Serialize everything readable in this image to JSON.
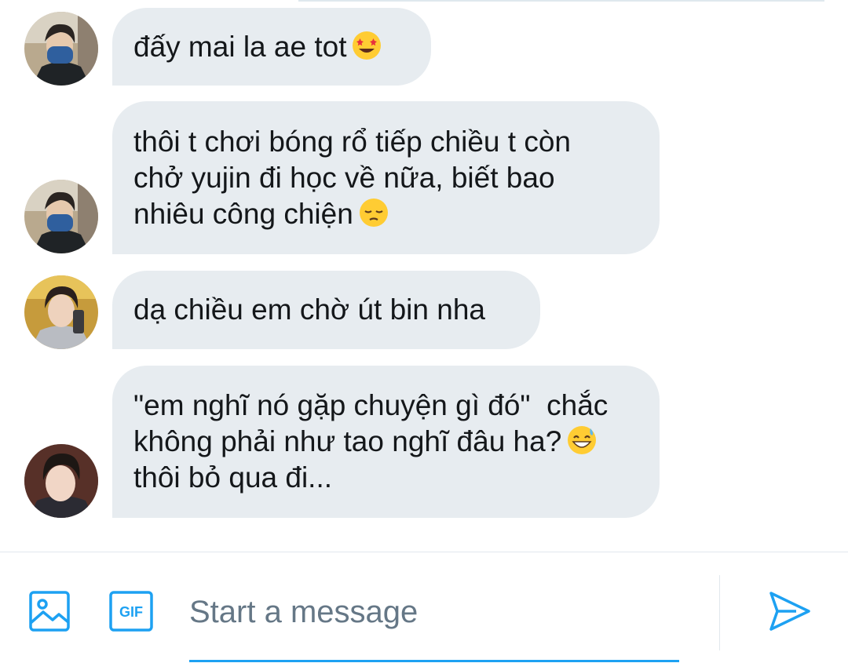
{
  "messages": [
    {
      "text": "đấy mai la ae tot",
      "emoji": "star-struck-emoji"
    },
    {
      "text": "thôi t chơi bóng rổ tiếp chiều t còn\nchở yujin đi học về nữa, biết bao\nnhiêu công chiện",
      "emoji": "pensive-face-emoji"
    },
    {
      "text": "dạ chiều em chờ út bin nha",
      "emoji": ""
    },
    {
      "text": "\"em nghĩ nó gặp chuyện gì đó\"  chắc\nkhông phải như tao nghĩ đâu ha?",
      "text_after_emoji": "thôi bỏ qua đi...",
      "emoji": "grinning-sweat-emoji"
    }
  ],
  "composer": {
    "placeholder": "Start a message",
    "image_icon": "image-icon",
    "gif_icon": "gif-icon",
    "gif_label": "GIF",
    "send_icon": "send-icon"
  },
  "colors": {
    "accent": "#1da1f2",
    "bubble": "#e7ecf0",
    "text": "#14171a",
    "placeholder": "#657786"
  }
}
